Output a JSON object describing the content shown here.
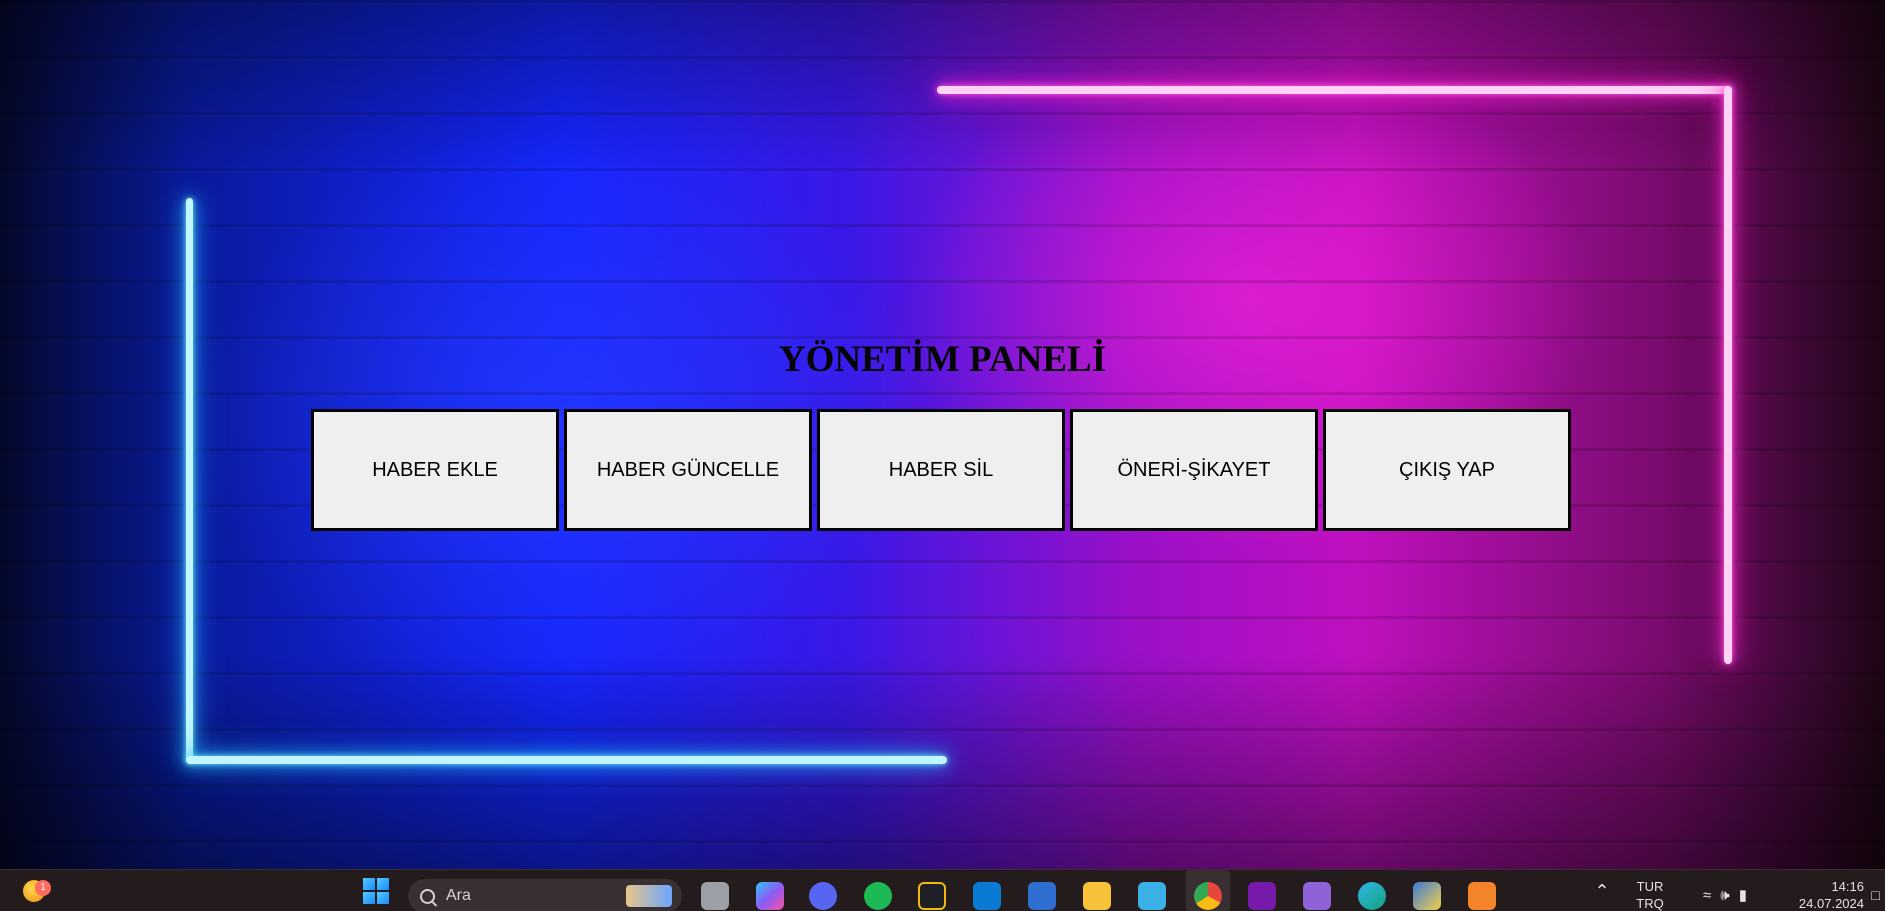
{
  "page": {
    "title": "YÖNETİM PANELİ"
  },
  "buttons": [
    {
      "label": "HABER EKLE"
    },
    {
      "label": "HABER GÜNCELLE"
    },
    {
      "label": "HABER SİL"
    },
    {
      "label": "ÖNERİ-ŞİKAYET"
    },
    {
      "label": "ÇIKIŞ YAP"
    }
  ],
  "taskbar": {
    "weather_badge": "1",
    "search_placeholder": "Ara",
    "apps": [
      {
        "name": "task-view",
        "color": "#9aa0a6"
      },
      {
        "name": "copilot",
        "color": "#6a6cf0"
      },
      {
        "name": "discord",
        "color": "#5865f2"
      },
      {
        "name": "spotify",
        "color": "#1db954"
      },
      {
        "name": "binance",
        "color": "#f0b90b"
      },
      {
        "name": "vscode",
        "color": "#0a7ad4"
      },
      {
        "name": "devhome",
        "color": "#2f6fd1"
      },
      {
        "name": "file-explorer",
        "color": "#f6c23a"
      },
      {
        "name": "notepad",
        "color": "#3ab0e6"
      },
      {
        "name": "chrome",
        "color": "#e8453c"
      },
      {
        "name": "onenote",
        "color": "#7719aa"
      },
      {
        "name": "visual-studio",
        "color": "#9062d8"
      },
      {
        "name": "edge",
        "color": "#15a07f"
      },
      {
        "name": "python-ide",
        "color": "#3c78d8"
      },
      {
        "name": "xampp",
        "color": "#f5832a"
      }
    ],
    "language_line1": "TUR",
    "language_line2": "TRQ",
    "time": "14:16",
    "date": "24.07.2024"
  }
}
